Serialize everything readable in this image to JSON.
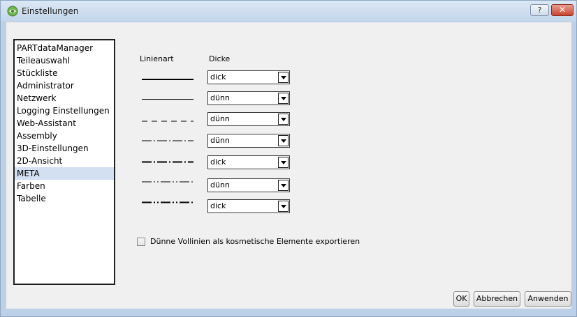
{
  "window": {
    "title": "Einstellungen",
    "help_glyph": "?",
    "close_glyph": "✕"
  },
  "nav": {
    "items": [
      {
        "label": "PARTdataManager"
      },
      {
        "label": "Teileauswahl"
      },
      {
        "label": "Stückliste"
      },
      {
        "label": "Administrator"
      },
      {
        "label": "Netzwerk"
      },
      {
        "label": "Logging Einstellungen"
      },
      {
        "label": "Web-Assistant"
      },
      {
        "label": "Assembly"
      },
      {
        "label": "3D-Einstellungen"
      },
      {
        "label": "2D-Ansicht"
      },
      {
        "label": "META",
        "selected": true
      },
      {
        "label": "Farben"
      },
      {
        "label": "Tabelle"
      }
    ]
  },
  "lines": {
    "col_linetype": "Linienart",
    "col_thickness": "Dicke",
    "rows": [
      {
        "style": "solid",
        "weight": "dick",
        "value": "dick"
      },
      {
        "style": "solid",
        "weight": "dünn",
        "value": "dünn"
      },
      {
        "style": "dashed",
        "weight": "dünn",
        "value": "dünn"
      },
      {
        "style": "dash-dot",
        "weight": "dünn",
        "value": "dünn"
      },
      {
        "style": "dash-dot",
        "weight": "dick",
        "value": "dick"
      },
      {
        "style": "dash-dot-dot",
        "weight": "dünn",
        "value": "dünn"
      },
      {
        "style": "dash-dot-dot",
        "weight": "dick",
        "value": "dick"
      }
    ]
  },
  "export_option": {
    "label": "Dünne Vollinien als kosmetische Elemente exportieren",
    "checked": false
  },
  "buttons": {
    "ok": "OK",
    "cancel": "Abbrechen",
    "apply": "Anwenden"
  }
}
